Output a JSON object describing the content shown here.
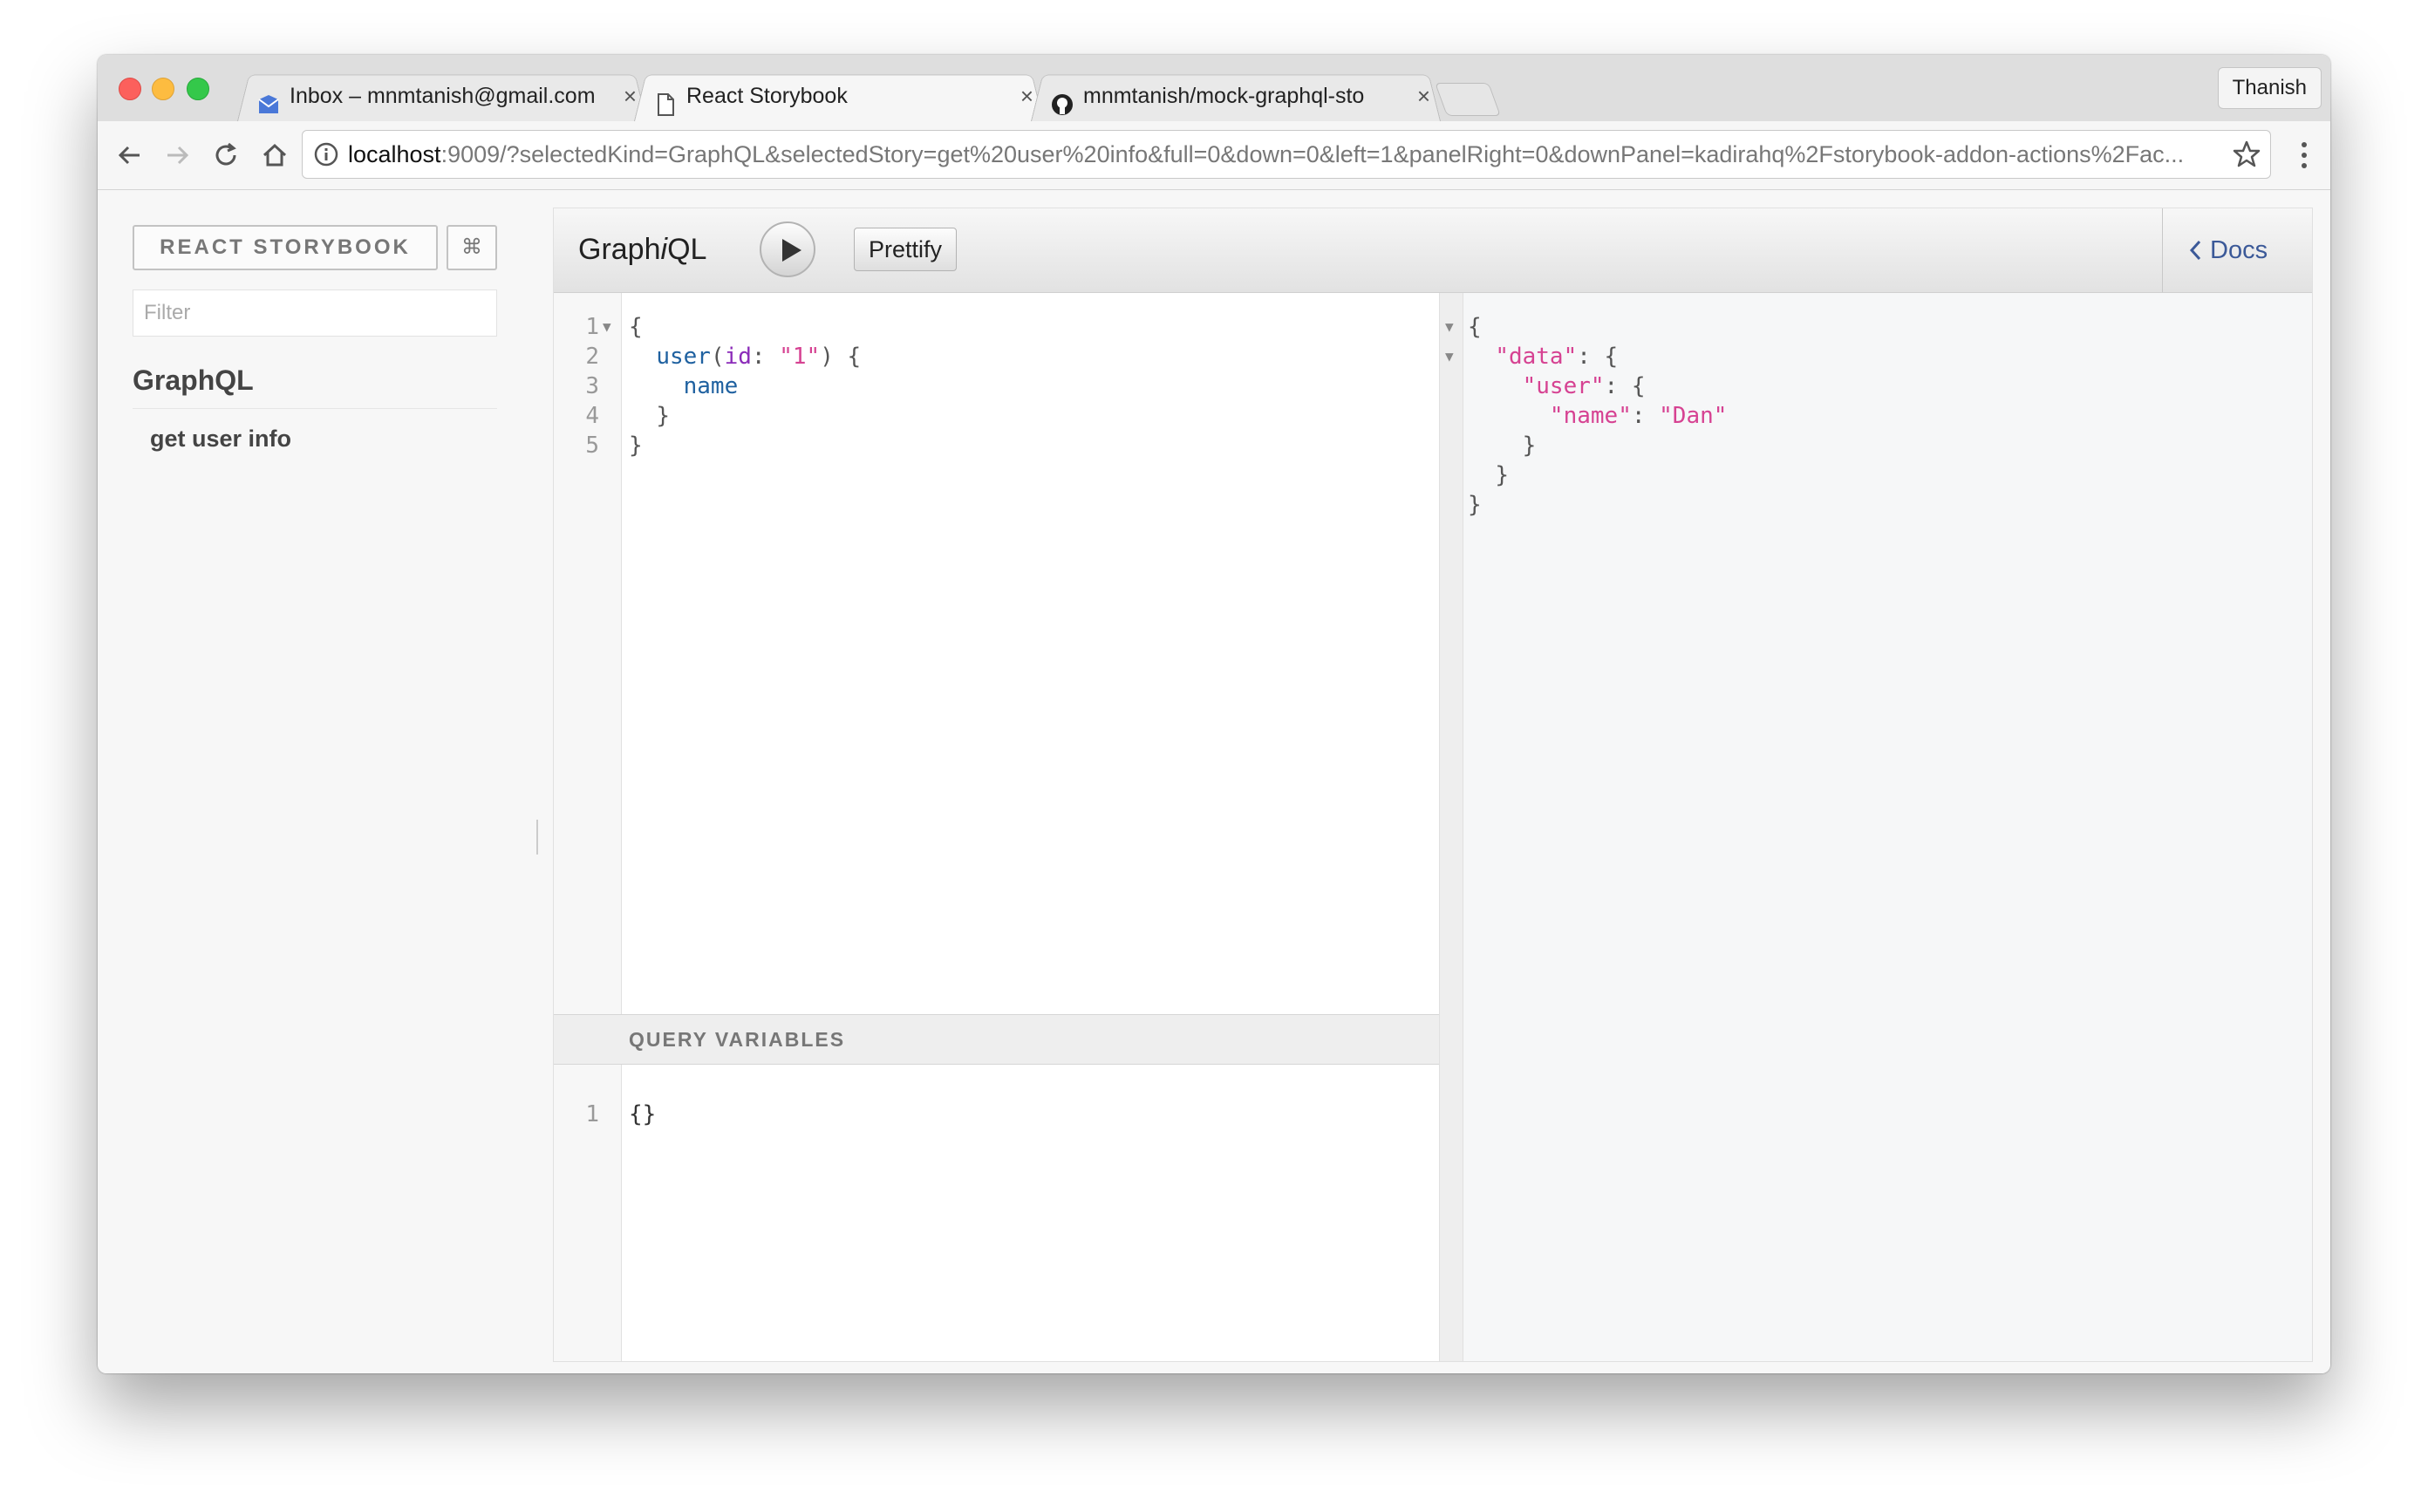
{
  "browser": {
    "tabs": [
      {
        "title": "Inbox – mnmtanish@gmail.com",
        "icon": "inbox-icon",
        "active": false
      },
      {
        "title": "React Storybook",
        "icon": "document-icon",
        "active": true
      },
      {
        "title": "mnmtanish/mock-graphql-sto",
        "icon": "github-icon",
        "active": false
      }
    ],
    "profile_name": "Thanish",
    "url_host": "localhost",
    "url_rest": ":9009/?selectedKind=GraphQL&selectedStory=get%20user%20info&full=0&down=0&left=1&panelRight=0&downPanel=kadirahq%2Fstorybook-addon-actions%2Fac..."
  },
  "sidebar": {
    "brand": "REACT STORYBOOK",
    "shortcut": "⌘",
    "filter_placeholder": "Filter",
    "kind": "GraphQL",
    "story": "get user info"
  },
  "graphiql": {
    "title_pre": "Graph",
    "title_i": "i",
    "title_post": "QL",
    "prettify": "Prettify",
    "docs": "Docs",
    "query_variables_label": "QUERY VARIABLES",
    "query_lines": [
      "1",
      "2",
      "3",
      "4",
      "5"
    ],
    "query_code": {
      "l1": "{",
      "l2_field": "user",
      "l2_open": "(",
      "l2_arg": "id",
      "l2_colon": ": ",
      "l2_str": "\"1\"",
      "l2_close": ") {",
      "l3_field": "name",
      "l4": "}",
      "l5": "}"
    },
    "variables_line": "1",
    "variables_code": "{}",
    "result": {
      "l1": "{",
      "l2_key": "\"data\"",
      "l2_rest": ": {",
      "l3_key": "\"user\"",
      "l3_rest": ": {",
      "l4_key": "\"name\"",
      "l4_colon": ": ",
      "l4_val": "\"Dan\"",
      "l5": "}",
      "l6": "}",
      "l7": "}"
    }
  },
  "colors": {
    "field": "#1f61a0",
    "argument": "#8b2bb9",
    "string": "#d64292",
    "docs_link": "#3b5998"
  }
}
